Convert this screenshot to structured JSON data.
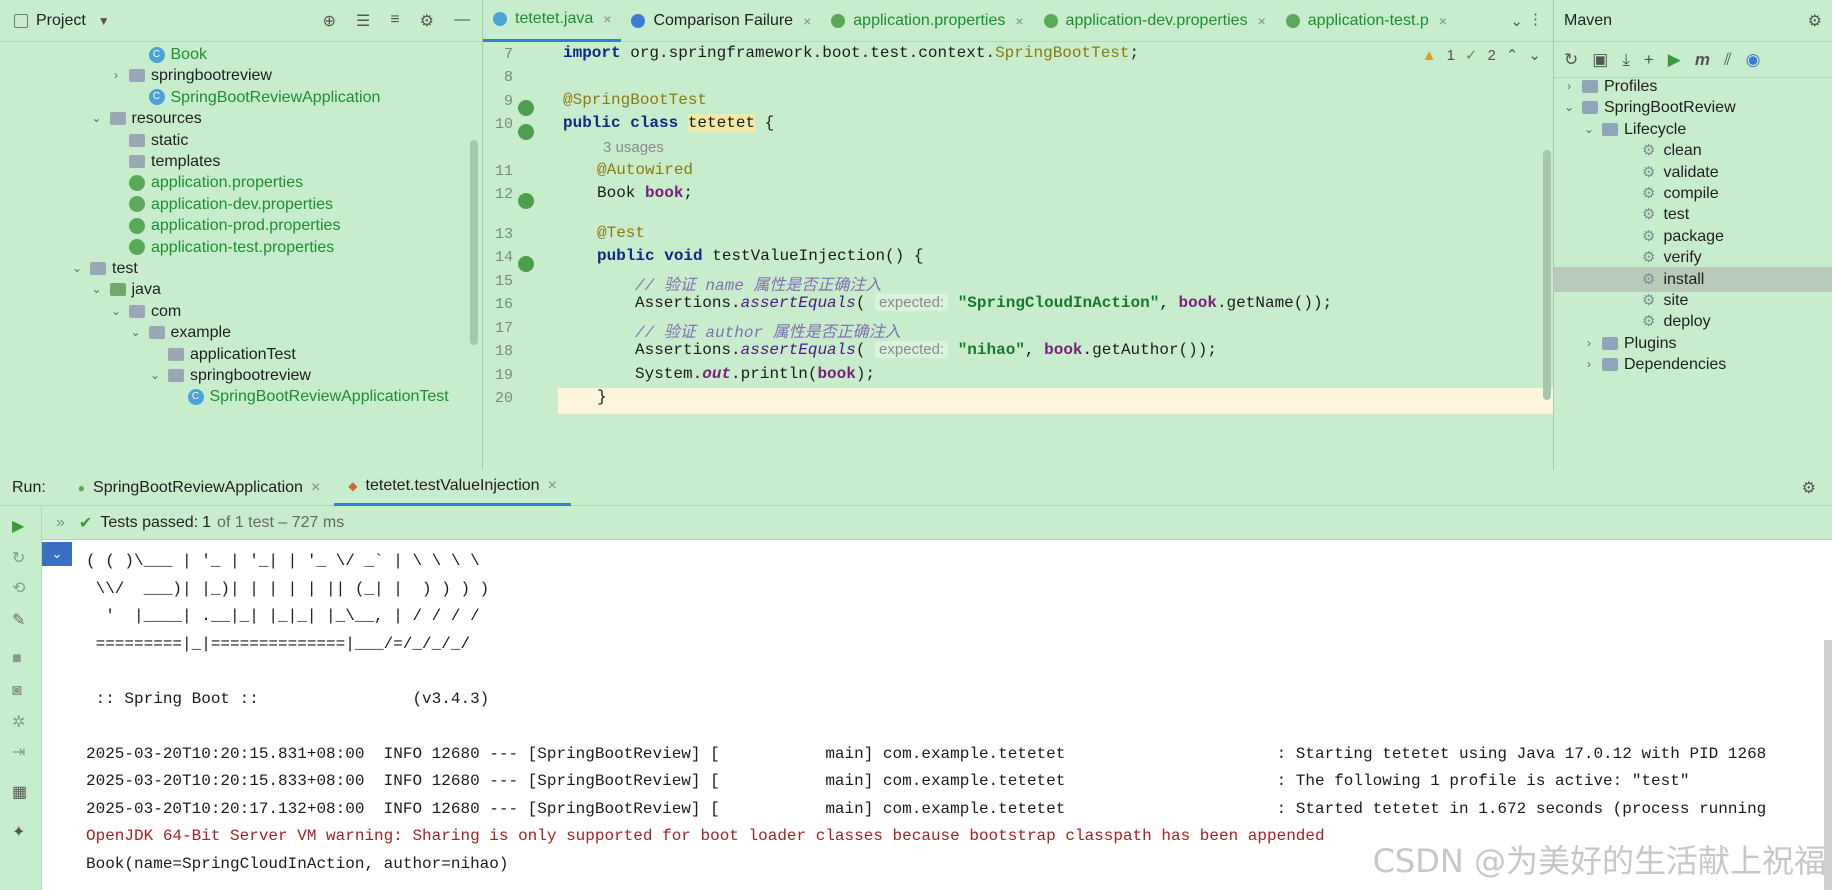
{
  "project": {
    "title": "Project",
    "tree": [
      {
        "label": "Book",
        "type": "class",
        "indent": 3,
        "green": true
      },
      {
        "label": "springbootreview",
        "type": "package",
        "indent": 2,
        "arrow": "›"
      },
      {
        "label": "SpringBootReviewApplication",
        "type": "class",
        "indent": 3,
        "green": true
      },
      {
        "label": "resources",
        "type": "folder",
        "indent": 1,
        "arrow": "⌄"
      },
      {
        "label": "static",
        "type": "folder",
        "indent": 2
      },
      {
        "label": "templates",
        "type": "folder",
        "indent": 2
      },
      {
        "label": "application.properties",
        "type": "leaf",
        "indent": 2,
        "green": true
      },
      {
        "label": "application-dev.properties",
        "type": "leaf",
        "indent": 2,
        "green": true
      },
      {
        "label": "application-prod.properties",
        "type": "leaf",
        "indent": 2,
        "green": true
      },
      {
        "label": "application-test.properties",
        "type": "leaf",
        "indent": 2,
        "green": true
      },
      {
        "label": "test",
        "type": "folder",
        "indent": 0,
        "arrow": "⌄"
      },
      {
        "label": "java",
        "type": "javafolder",
        "indent": 1,
        "arrow": "⌄"
      },
      {
        "label": "com",
        "type": "package",
        "indent": 2,
        "arrow": "⌄"
      },
      {
        "label": "example",
        "type": "package",
        "indent": 3,
        "arrow": "⌄"
      },
      {
        "label": "applicationTest",
        "type": "package",
        "indent": 4
      },
      {
        "label": "springbootreview",
        "type": "package",
        "indent": 4,
        "arrow": "⌄"
      },
      {
        "label": "SpringBootReviewApplicationTest",
        "type": "class",
        "indent": 5,
        "green": true
      }
    ]
  },
  "editor": {
    "tabs": [
      {
        "label": "tetetet.java",
        "active": true,
        "color": "#4aa2d8",
        "green": true
      },
      {
        "label": "Comparison Failure",
        "active": false,
        "color": "#3b7bd0",
        "green": false
      },
      {
        "label": "application.properties",
        "active": false,
        "color": "#5aa95a",
        "green": true
      },
      {
        "label": "application-dev.properties",
        "active": false,
        "color": "#5aa95a",
        "green": true
      },
      {
        "label": "application-test.p",
        "active": false,
        "color": "#5aa95a",
        "green": true
      }
    ],
    "inspection": {
      "warnings": "1",
      "weak": "2"
    },
    "line_numbers": [
      "7",
      "8",
      "9",
      "10",
      "11",
      "12",
      "13",
      "14",
      "15",
      "16",
      "17",
      "18",
      "19",
      "20"
    ],
    "usages": "3 usages",
    "hint_expected": "expected:",
    "code": {
      "l7_kw": "import",
      "l7_rest": " org.springframework.boot.test.context.",
      "l7_cls": "SpringBootTest",
      "l7_end": ";",
      "l9": "@SpringBootTest",
      "l10_kw": "public class",
      "l10_name": "tetetet",
      "l10_end": " {",
      "l11": "@Autowired",
      "l12_type": "Book ",
      "l12_var": "book",
      "l12_end": ";",
      "l13": "@Test",
      "l14_kw": "public void",
      "l14_rest": " testValueInjection() {",
      "l15": "// 验证 name 属性是否正确注入",
      "l16_a": "Assertions.",
      "l16_m": "assertEquals",
      "l16_p": "( ",
      "l16_s": "\"SpringCloudInAction\"",
      "l16_c": ", ",
      "l16_v": "book",
      "l16_e": ".getName());",
      "l17": "// 验证 author 属性是否正确注入",
      "l18_s": "\"nihao\"",
      "l18_e": ".getAuthor());",
      "l19_a": "System.",
      "l19_o": "out",
      "l19_b": ".println(",
      "l19_v": "book",
      "l19_e": ");",
      "l20": "}"
    }
  },
  "maven": {
    "title": "Maven",
    "items": [
      {
        "label": "Profiles",
        "indent": 0,
        "arrow": "›"
      },
      {
        "label": "SpringBootReview",
        "indent": 0,
        "arrow": "⌄"
      },
      {
        "label": "Lifecycle",
        "indent": 1,
        "arrow": "⌄"
      },
      {
        "label": "clean",
        "indent": 2,
        "gear": true
      },
      {
        "label": "validate",
        "indent": 2,
        "gear": true
      },
      {
        "label": "compile",
        "indent": 2,
        "gear": true
      },
      {
        "label": "test",
        "indent": 2,
        "gear": true
      },
      {
        "label": "package",
        "indent": 2,
        "gear": true
      },
      {
        "label": "verify",
        "indent": 2,
        "gear": true
      },
      {
        "label": "install",
        "indent": 2,
        "gear": true,
        "selected": true
      },
      {
        "label": "site",
        "indent": 2,
        "gear": true
      },
      {
        "label": "deploy",
        "indent": 2,
        "gear": true
      },
      {
        "label": "Plugins",
        "indent": 1,
        "arrow": "›"
      },
      {
        "label": "Dependencies",
        "indent": 1,
        "arrow": "›"
      }
    ]
  },
  "run": {
    "label": "Run:",
    "tabs": [
      {
        "label": "SpringBootReviewApplication",
        "active": false
      },
      {
        "label": "tetetet.testValueInjection",
        "active": true
      }
    ],
    "tests_passed": "Tests passed:",
    "tests_count": "1",
    "tests_detail": "of 1 test – 727 ms",
    "console": [
      {
        "text": "( ( )\\___ | '_ | '_| | '_ \\/ _` | \\ \\ \\ \\",
        "warn": false
      },
      {
        "text": " \\\\/  ___)| |_)| | | | | || (_| |  ) ) ) )",
        "warn": false
      },
      {
        "text": "  '  |____| .__|_| |_|_| |_\\__, | / / / /",
        "warn": false
      },
      {
        "text": " =========|_|==============|___/=/_/_/_/",
        "warn": false
      },
      {
        "text": "",
        "warn": false
      },
      {
        "text": " :: Spring Boot ::                (v3.4.3)",
        "warn": false
      },
      {
        "text": "",
        "warn": false
      },
      {
        "text": "2025-03-20T10:20:15.831+08:00  INFO 12680 --- [SpringBootReview] [           main] com.example.tetetet                      : Starting tetetet using Java 17.0.12 with PID 1268",
        "warn": false
      },
      {
        "text": "2025-03-20T10:20:15.833+08:00  INFO 12680 --- [SpringBootReview] [           main] com.example.tetetet                      : The following 1 profile is active: \"test\"",
        "warn": false
      },
      {
        "text": "2025-03-20T10:20:17.132+08:00  INFO 12680 --- [SpringBootReview] [           main] com.example.tetetet                      : Started tetetet in 1.672 seconds (process running",
        "warn": false
      },
      {
        "text": "OpenJDK 64-Bit Server VM warning: Sharing is only supported for boot loader classes because bootstrap classpath has been appended",
        "warn": true
      },
      {
        "text": "Book(name=SpringCloudInAction, author=nihao)",
        "warn": false
      }
    ]
  },
  "watermark": "CSDN @为美好的生活献上祝福"
}
